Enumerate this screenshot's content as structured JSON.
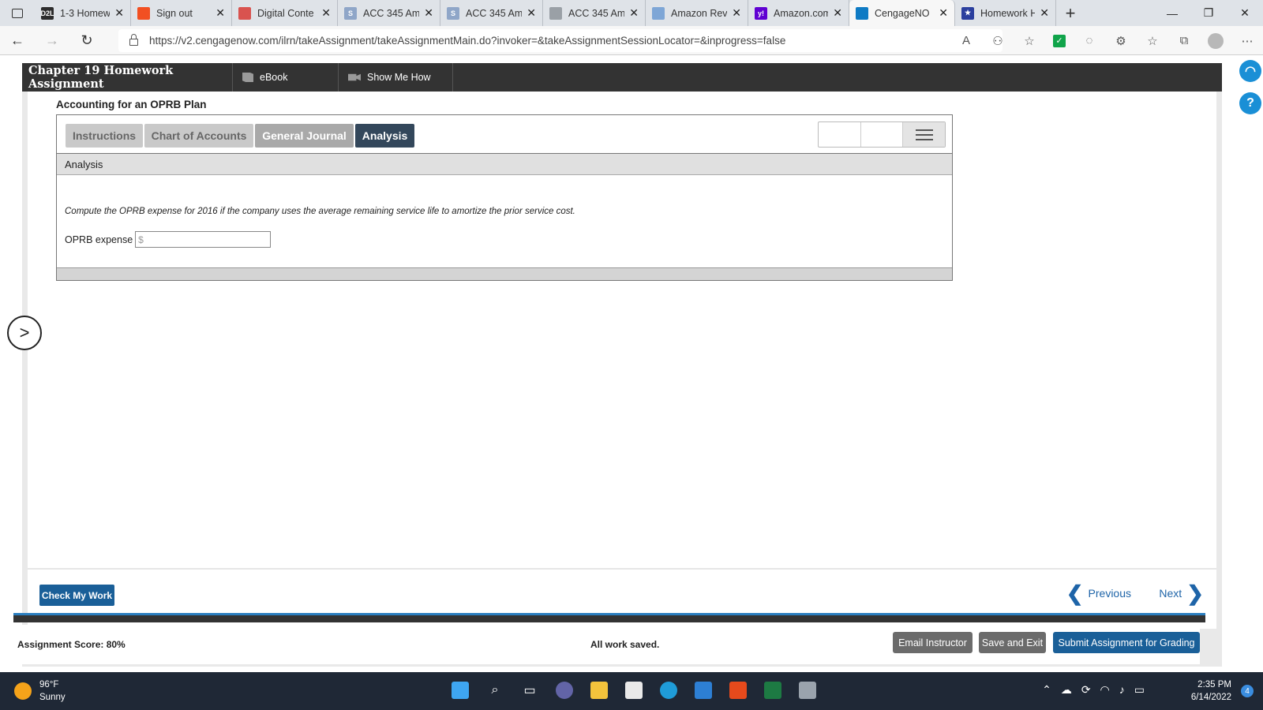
{
  "browser": {
    "tabs": [
      {
        "title": "1-3 Homewc",
        "favicon": "d2l-icon",
        "color": "#2d2d2d",
        "label": "D2L"
      },
      {
        "title": "Sign out",
        "favicon": "microsoft-icon",
        "color": "#f25022",
        "label": ""
      },
      {
        "title": "Digital Conte",
        "favicon": "book-icon",
        "color": "#d9534f",
        "label": ""
      },
      {
        "title": "ACC 345 Am",
        "favicon": "s-icon",
        "color": "#8fa6c8",
        "label": "S"
      },
      {
        "title": "ACC 345 Am",
        "favicon": "s-icon",
        "color": "#8fa6c8",
        "label": "S"
      },
      {
        "title": "ACC 345 Am",
        "favicon": "document-icon",
        "color": "#9aa0a6",
        "label": ""
      },
      {
        "title": "Amazon Rev",
        "favicon": "chart-icon",
        "color": "#7ea6d6",
        "label": ""
      },
      {
        "title": "Amazon.com",
        "favicon": "yahoo-icon",
        "color": "#6001d2",
        "label": "y!"
      },
      {
        "title": "CengageNO",
        "favicon": "cengage-icon",
        "color": "#0f7bc4",
        "label": ""
      },
      {
        "title": "Homework H",
        "favicon": "star-icon",
        "color": "#2b3f9e",
        "label": "★"
      }
    ],
    "active_tab_index": 8,
    "new_tab_label": "+",
    "url": "https://v2.cengagenow.com/ilrn/takeAssignment/takeAssignmentMain.do?invoker=&takeAssignmentSessionLocator=&inprogress=false"
  },
  "app": {
    "title": "Chapter 19 Homework Assignment",
    "ebook_label": "eBook",
    "show_me_how_label": "Show Me How",
    "section_title": "Accounting for an OPRB Plan",
    "tabs": [
      {
        "label": "Instructions",
        "state": "inactive"
      },
      {
        "label": "Chart of Accounts",
        "state": "inactive"
      },
      {
        "label": "General Journal",
        "state": "partial"
      },
      {
        "label": "Analysis",
        "state": "active"
      }
    ],
    "panel_header": "Analysis",
    "question": "Compute the OPRB expense for 2016 if the company uses the average remaining service life to amortize the prior service cost.",
    "field_label": "OPRB expense",
    "field_placeholder": "$",
    "field_value": "",
    "check_my_work_label": "Check My Work",
    "previous_label": "Previous",
    "next_label": "Next",
    "score_text": "Assignment Score: 80%",
    "saved_text": "All work saved.",
    "email_instructor_label": "Email Instructor",
    "save_exit_label": "Save and Exit",
    "submit_label": "Submit Assignment for Grading"
  },
  "taskbar": {
    "temperature": "96°F",
    "condition": "Sunny",
    "time": "2:35 PM",
    "date": "6/14/2022",
    "notification_count": "4"
  },
  "colors": {
    "header_bg": "#333333",
    "active_tab": "#33475b",
    "primary_button": "#1a5f98",
    "link_blue": "#1e64a8"
  }
}
